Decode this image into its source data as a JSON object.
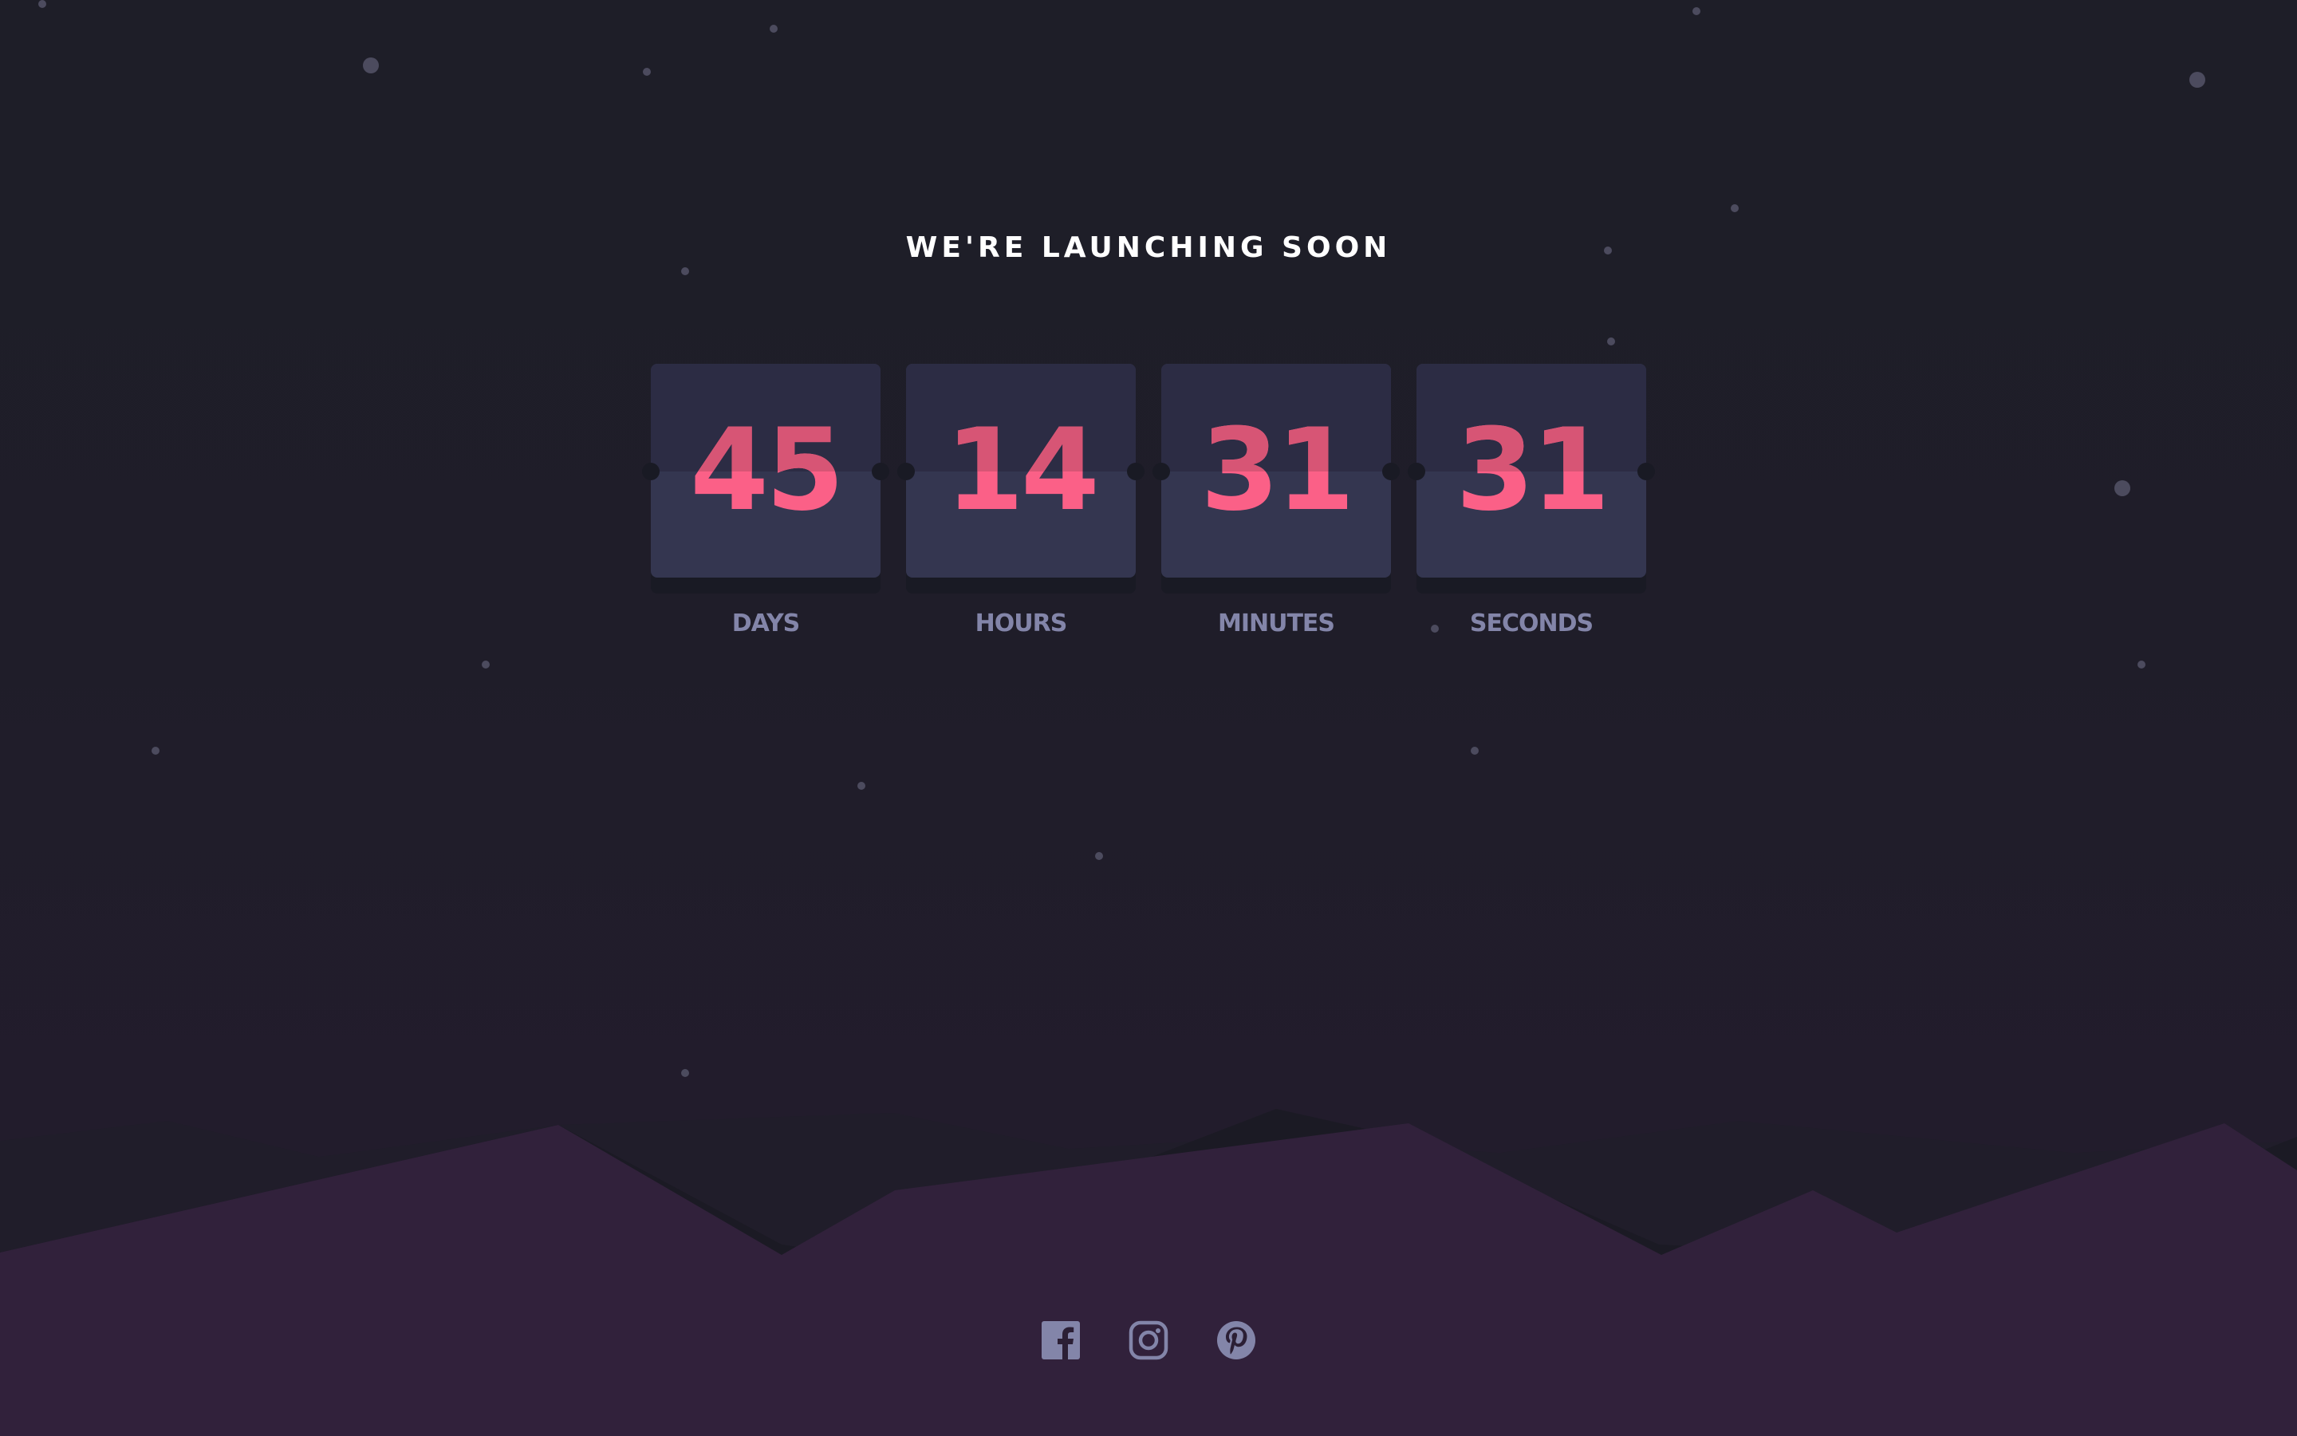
{
  "page": {
    "title": "WE'RE LAUNCHING SOON"
  },
  "countdown": [
    {
      "value": "45",
      "label": "DAYS"
    },
    {
      "value": "14",
      "label": "HOURS"
    },
    {
      "value": "31",
      "label": "MINUTES"
    },
    {
      "value": "31",
      "label": "SECONDS"
    }
  ],
  "social": [
    {
      "icon": "facebook-icon"
    },
    {
      "icon": "instagram-icon"
    },
    {
      "icon": "pinterest-icon"
    }
  ],
  "colors": {
    "accent": "#fb6087",
    "accent_dim": "#d75575",
    "label": "#8385a9",
    "card": "#343650",
    "card_top": "#2c2c44",
    "background": "#1e1e28",
    "hills": "#31213b"
  }
}
